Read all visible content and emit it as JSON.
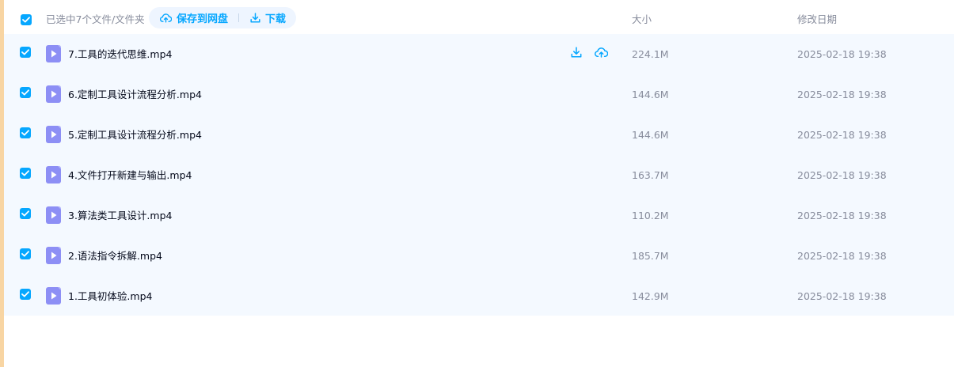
{
  "header": {
    "selection_text": "已选中7个文件/文件夹",
    "save_label": "保存到网盘",
    "download_label": "下载",
    "col_size": "大小",
    "col_date": "修改日期"
  },
  "files": [
    {
      "name": "7.工具的迭代思维.mp4",
      "size": "224.1M",
      "date": "2025-02-18 19:38"
    },
    {
      "name": "6.定制工具设计流程分析.mp4",
      "size": "144.6M",
      "date": "2025-02-18 19:38"
    },
    {
      "name": "5.定制工具设计流程分析.mp4",
      "size": "144.6M",
      "date": "2025-02-18 19:38"
    },
    {
      "name": "4.文件打开新建与输出.mp4",
      "size": "163.7M",
      "date": "2025-02-18 19:38"
    },
    {
      "name": "3.算法类工具设计.mp4",
      "size": "110.2M",
      "date": "2025-02-18 19:38"
    },
    {
      "name": "2.语法指令拆解.mp4",
      "size": "185.7M",
      "date": "2025-02-18 19:38"
    },
    {
      "name": "1.工具初体验.mp4",
      "size": "142.9M",
      "date": "2025-02-18 19:38"
    }
  ],
  "colors": {
    "accent": "#06a7ff",
    "row_bg": "#f4f9ff",
    "left_bar": "#f8d5a3",
    "muted_text": "#878c9c",
    "video_icon": "#8d8ff5"
  }
}
